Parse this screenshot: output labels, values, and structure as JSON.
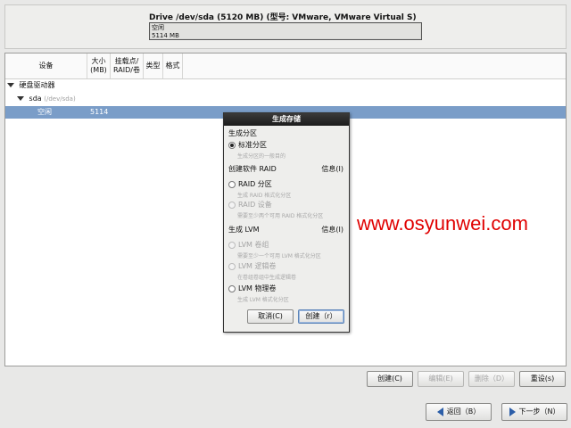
{
  "drive": {
    "title": "Drive /dev/sda (5120 MB) (型号: VMware, VMware Virtual S)",
    "bar_free_label": "空闲",
    "bar_free_size": "5114 MB"
  },
  "table": {
    "headers": {
      "device": "设备",
      "size_line1": "大小",
      "size_line2": "(MB)",
      "mount_line1": "挂载点/",
      "mount_line2": "RAID/卷",
      "type": "类型",
      "format": "格式"
    },
    "rows": {
      "group_label": "硬盘驱动器",
      "disk_label": "sda",
      "disk_path": "(/dev/sda)",
      "free_label": "空闲",
      "free_size": "5114"
    }
  },
  "watermark": "www.osyunwei.com",
  "dialog": {
    "title": "生成存储",
    "section_create_partition": "生成分区",
    "opt_standard": "标准分区",
    "opt_standard_desc": "生成分区的一般目的",
    "section_raid": "创建软件 RAID",
    "info_raid": "信息(I)",
    "opt_raid_partition": "RAID 分区",
    "opt_raid_partition_desc": "生成 RAID 格式化分区",
    "opt_raid_device": "RAID 设备",
    "opt_raid_device_desc": "需要至少两个可用 RAID 格式化分区",
    "section_lvm": "生成 LVM",
    "info_lvm": "信息(I)",
    "opt_lvm_vg": "LVM 卷组",
    "opt_lvm_vg_desc": "需要至少一个可用 LVM 格式化分区",
    "opt_lvm_lv": "LVM 逻辑卷",
    "opt_lvm_lv_desc": "在卷组卷组中生成逻辑卷",
    "opt_lvm_pv": "LVM 物理卷",
    "opt_lvm_pv_desc": "生成 LVM 格式化分区",
    "cancel": "取消(C)",
    "create": "创建（r）"
  },
  "actions": {
    "create": "创建(C)",
    "edit": "编辑(E)",
    "delete": "删除（D）",
    "reset": "重设(s)"
  },
  "nav": {
    "back": "返回（B）",
    "next": "下一步（N）"
  },
  "colors": {
    "selected_row": "#7a9dc8",
    "watermark": "#e00000",
    "arrow": "#2c5ea8"
  }
}
